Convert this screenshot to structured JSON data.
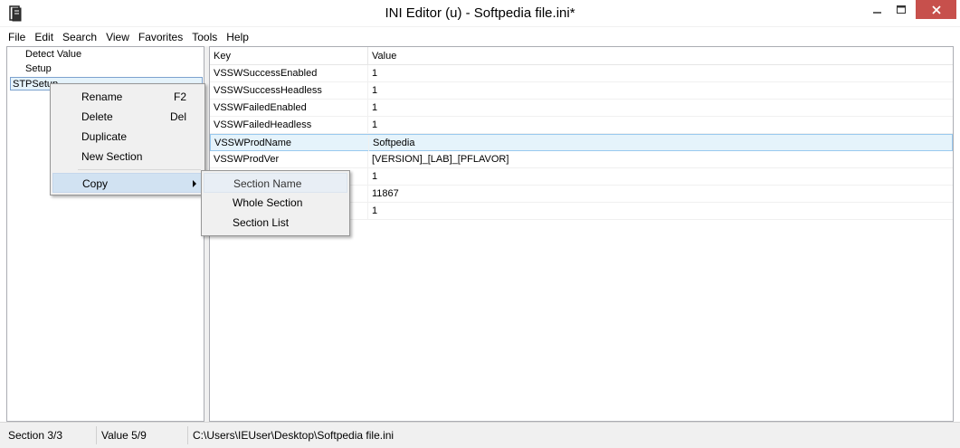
{
  "window": {
    "title": "INI Editor (u) - Softpedia file.ini*",
    "close_color": "#c7504c",
    "accent_color": "#e5f3fb"
  },
  "menu": [
    "File",
    "Edit",
    "Search",
    "View",
    "Favorites",
    "Tools",
    "Help"
  ],
  "tree": {
    "items": [
      {
        "label": "Detect Value",
        "selected": false
      },
      {
        "label": "Setup",
        "selected": false
      },
      {
        "label": "STPSetup",
        "selected": true
      }
    ]
  },
  "table": {
    "headers": {
      "key": "Key",
      "value": "Value"
    },
    "rows": [
      {
        "key": "VSSWSuccessEnabled",
        "value": "1"
      },
      {
        "key": "VSSWSuccessHeadless",
        "value": "1"
      },
      {
        "key": "VSSWFailedEnabled",
        "value": "1"
      },
      {
        "key": "VSSWFailedHeadless",
        "value": "1"
      },
      {
        "key": "VSSWProdName",
        "value": "Softpedia",
        "selected": true
      },
      {
        "key": "VSSWProdVer",
        "value": "[VERSION]_[LAB]_[PFLAVOR]"
      },
      {
        "key": "",
        "value": "1"
      },
      {
        "key": "",
        "value": "11867"
      },
      {
        "key": "",
        "value": "1"
      }
    ]
  },
  "context_menu": {
    "items": [
      {
        "label": "Rename",
        "shortcut": "F2"
      },
      {
        "label": "Delete",
        "shortcut": "Del"
      },
      {
        "label": "Duplicate",
        "shortcut": ""
      },
      {
        "label": "New Section",
        "shortcut": ""
      },
      {
        "label": "Copy",
        "shortcut": "",
        "submenu": true
      }
    ]
  },
  "sub_menu": {
    "items": [
      "Section Name",
      "Whole Section",
      "Section List"
    ]
  },
  "status": {
    "section": "Section 3/3",
    "value": "Value 5/9",
    "path": "C:\\Users\\IEUser\\Desktop\\Softpedia file.ini"
  }
}
